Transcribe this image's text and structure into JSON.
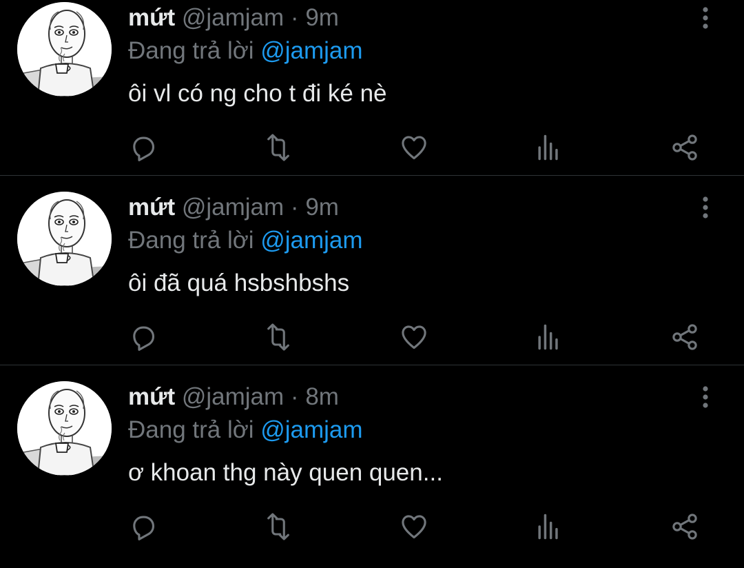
{
  "tweets": [
    {
      "name": "mứt",
      "handle": "@jamjam",
      "separator": "·",
      "time": "9m",
      "reply_prefix": "Đang trả lời",
      "reply_to": "@jamjam",
      "text": "ôi vl có ng cho t đi ké nè"
    },
    {
      "name": "mứt",
      "handle": "@jamjam",
      "separator": "·",
      "time": "9m",
      "reply_prefix": "Đang trả lời",
      "reply_to": "@jamjam",
      "text": "ôi đã quá hsbshbshs"
    },
    {
      "name": "mứt",
      "handle": "@jamjam",
      "separator": "·",
      "time": "8m",
      "reply_prefix": "Đang trả lời",
      "reply_to": "@jamjam",
      "text": "ơ khoan thg này quen quen..."
    }
  ],
  "icons": {
    "reply": "reply-icon",
    "retweet": "retweet-icon",
    "like": "heart-icon",
    "views": "views-icon",
    "share": "share-icon",
    "more": "more-vertical-icon"
  },
  "colors": {
    "background": "#000000",
    "primary_text": "#e7e9ea",
    "secondary_text": "#71767b",
    "mention": "#1d9bf0",
    "divider": "#2f3336"
  }
}
